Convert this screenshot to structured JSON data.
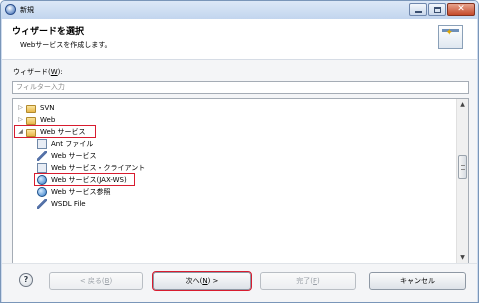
{
  "window": {
    "title": "新規"
  },
  "header": {
    "title": "ウィザードを選択",
    "subtitle": "Webサービスを作成します。"
  },
  "wizard_label": {
    "text": "ウィザード(",
    "key": "W",
    "suffix": "):"
  },
  "filter": {
    "placeholder": "フィルター入力",
    "value": ""
  },
  "tree": {
    "items": [
      {
        "label": "SVN",
        "icon": "folder-icon",
        "expanded": false
      },
      {
        "label": "Web",
        "icon": "folder-icon",
        "expanded": false
      },
      {
        "label": "Web サービス",
        "icon": "folder-icon",
        "expanded": true,
        "highlighted": true
      },
      {
        "label": "Ant ファイル",
        "icon": "ant-file-icon"
      },
      {
        "label": "Web サービス",
        "icon": "web-service-wand-icon"
      },
      {
        "label": "Web サービス・クライアント",
        "icon": "web-service-client-icon"
      },
      {
        "label": "Web サービス(JAX-WS)",
        "icon": "web-service-jaxws-icon",
        "highlighted": true
      },
      {
        "label": "Web サービス参照",
        "icon": "web-service-reference-icon"
      },
      {
        "label": "WSDL File",
        "icon": "wsdl-file-icon"
      }
    ]
  },
  "buttons": {
    "back": {
      "label": "< 戻る(",
      "key": "B",
      "suffix": ")",
      "enabled": false
    },
    "next": {
      "label": "次へ(",
      "key": "N",
      "suffix": ") >",
      "enabled": true
    },
    "finish": {
      "label": "完了(",
      "key": "F",
      "suffix": ")",
      "enabled": false
    },
    "cancel": {
      "label": "キャンセル",
      "enabled": true
    },
    "help": {
      "label": "?"
    }
  },
  "colors": {
    "highlight": "#d81c2f",
    "title_bar": "#c2d5ee"
  }
}
